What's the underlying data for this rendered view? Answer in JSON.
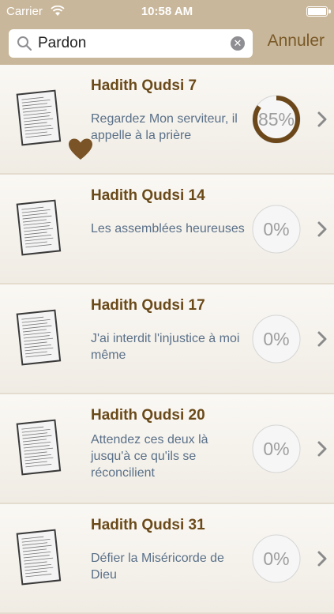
{
  "status": {
    "carrier": "Carrier",
    "time": "10:58 AM"
  },
  "search": {
    "value": "Pardon",
    "cancel_label": "Annuler"
  },
  "rows": [
    {
      "title": "Hadith Qudsi 7",
      "subtitle": "Regardez Mon serviteur, il appelle à la prière",
      "progress_label": "85%",
      "progress": 0.85,
      "favorite": true
    },
    {
      "title": "Hadith Qudsi 14",
      "subtitle": "Les assemblées heureuses",
      "progress_label": "0%",
      "progress": 0,
      "favorite": false
    },
    {
      "title": "Hadith Qudsi 17",
      "subtitle": "J'ai interdit l'injustice à moi même",
      "progress_label": "0%",
      "progress": 0,
      "favorite": false
    },
    {
      "title": "Hadith Qudsi 20",
      "subtitle": "Attendez ces deux là jusqu'à ce qu'ils se réconcilient",
      "progress_label": "0%",
      "progress": 0,
      "favorite": false
    },
    {
      "title": "Hadith Qudsi 31",
      "subtitle": "Défier la Miséricorde de Dieu",
      "progress_label": "0%",
      "progress": 0,
      "favorite": false
    }
  ],
  "colors": {
    "bar": "#c9b79b",
    "accent": "#7a5a28",
    "title": "#6b4a19",
    "subtitle": "#5a7088",
    "progress_ring": "#6b4719"
  }
}
